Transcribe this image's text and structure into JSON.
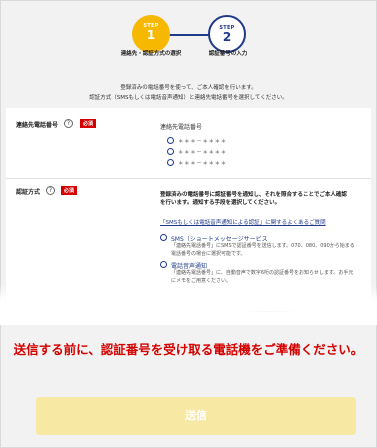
{
  "stepper": {
    "step1": {
      "label": "STEP",
      "number": "1",
      "caption": "連絡先・認証方式の選択"
    },
    "step2": {
      "label": "STEP",
      "number": "2",
      "caption": "認証番号の入力"
    }
  },
  "intro": {
    "line1": "登録済みの電話番号を使って、ご本人確認を行います。",
    "line2": "認証方式（SMSもしくは電話音声通知）と連絡先電話番号を選択してください。"
  },
  "contact_section": {
    "label": "連絡先電話番号",
    "help": "?",
    "required": "必須",
    "box_title": "連絡先電話番号",
    "options": [
      "＊＊＊－＊＊＊＊",
      "＊＊＊－＊＊＊＊",
      "＊＊＊－＊＊＊＊"
    ]
  },
  "method_section": {
    "label": "認証方式",
    "help": "?",
    "required": "必須",
    "desc_line1": "登録済みの電話番号に認証番号を通知し、それを照合することでご本人確認",
    "desc_line2": "を行います。通知する手段を選択してください。",
    "faq_link": "「SMSもしくは電話音声通知による認証」に関するよくあるご質問",
    "options": [
      {
        "title": "SMS（ショートメッセージサービス",
        "desc1": "「連絡先電話番号」にSMSで認証番号を送信します。070、080、090から始まる",
        "desc2": "電話番号の場合に選択可能です。"
      },
      {
        "title": "電話音声通知",
        "desc1": "「連絡先電話番号」に、自動音声で数字6桁の認証番号をお知らせします。お手元",
        "desc2": "にメモをご用意ください。"
      }
    ]
  },
  "notice": "送信する前に、認証番号を受け取る電話機をご準備ください。",
  "send_button": "送信",
  "colors": {
    "accent": "#f6b800",
    "navy": "#1f3a8a",
    "required": "#d40000",
    "button_disabled": "#f7e8a3"
  }
}
